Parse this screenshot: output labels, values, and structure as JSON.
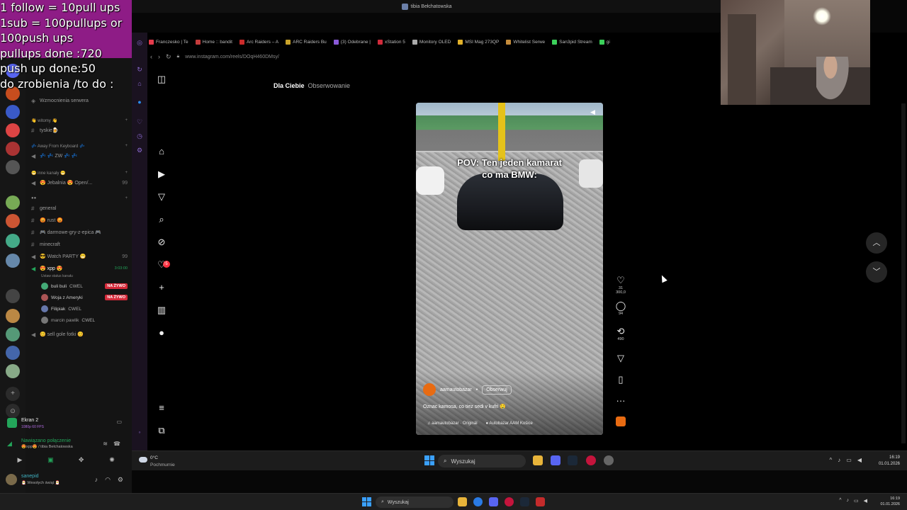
{
  "overlay": {
    "lines": [
      "1 follow = 10pull ups",
      "1sub = 100pullups or",
      "100push ups",
      "pullups done :720",
      "push up done:50",
      "do zrobienia /to do :"
    ]
  },
  "titlebar": {
    "title": "tibia Bełchatowska"
  },
  "discord": {
    "boost_label": "Wzmocnienia serwera",
    "categories": [
      "👋 witomy 👋",
      "💤 Away From Keyboard 💤",
      "😁 inne kanały 😁"
    ],
    "channels": {
      "tyskie": "tyskie🍺",
      "zw": "💤 💤 ZW 💤 💤",
      "jebalnia": "😍 Jebalnia 😍 Open/...",
      "jebalnia_count": "99",
      "general": "general",
      "rust": "😡 rust 😡",
      "darmowe": "🎮 darmowe-gry-z-epica 🎮",
      "minecraft": "minecraft",
      "watch_party": "😎 Watch PARTY 😁",
      "watch_party_count": "99",
      "xpp": "😍 xpp 😍",
      "xpp_time": "3:03:00",
      "xpp_status": "Ustaw status kanału",
      "sell": "😊 sell gole fotki 😊"
    },
    "voice_users": [
      {
        "name": "buli buli",
        "tag": "CWEL",
        "live": "NA ŻYWO"
      },
      {
        "name": "Woja z Ameryki",
        "tag": "",
        "live": "NA ŻYWO"
      },
      {
        "name": "Filipiak",
        "tag": "CWEL",
        "live": ""
      },
      {
        "name": "marcin pawlik",
        "tag": "CWEL",
        "live": ""
      }
    ],
    "screenshare": {
      "title": "Ekran 2",
      "quality": "1080p 60 FPS"
    },
    "voice": {
      "status": "Nawiązano połączenie",
      "channel": "😍xpp😍 / tibia Bełchatowska"
    },
    "user": {
      "name": "sanepid",
      "status": "🎅 Wesołych świąt 🎅"
    }
  },
  "browser": {
    "bookmarks": [
      "Franczesko | Te",
      "Home :: bandit",
      "Arc Raiders – A",
      "ARC Raiders Bu",
      "(3) Odebrane | ",
      "xStation 5",
      "Monitory OLED",
      "MSI Mag 273QP",
      "Whitelist Serwe",
      "San3pid Stream",
      "gi"
    ],
    "bookmark_colors": [
      "#e43b4c",
      "#c43b3b",
      "#cc2b2b",
      "#c9a32a",
      "#8a5ad8",
      "#d02b3b",
      "#aaaaaa",
      "#e2b22a",
      "#c48b3b",
      "#9ad04a",
      "#3bd05a",
      "#d05a5a"
    ],
    "url": "www.instagram.com/reels/DOqH460DMsy/"
  },
  "instagram": {
    "tab_active": "Dla Ciebie",
    "tab_inactive": "Obserwowanie",
    "notif_count": "5",
    "reel": {
      "caption_line1": "POV: Ten jeden kamarat",
      "caption_line2": "co ma BMW:",
      "author": "aamautobazar",
      "follow": "Obserwuj",
      "description": "Oznac kamosa, co tiez sedi v kufri 🤤",
      "audio": "aamautobazar · Originál",
      "location": "Autobazar AAM Košice"
    },
    "actions": {
      "likes": "31 300,0",
      "comments": "94",
      "reposts": "490"
    }
  },
  "taskbar_inner": {
    "temp": "0°C",
    "weather": "Pochmurnie",
    "search": "Wyszukaj",
    "time": "16:19",
    "date": "01.01.2026"
  },
  "taskbar_outer": {
    "search": "Wyszukaj",
    "time": "16:19",
    "date": "01.01.2026"
  }
}
